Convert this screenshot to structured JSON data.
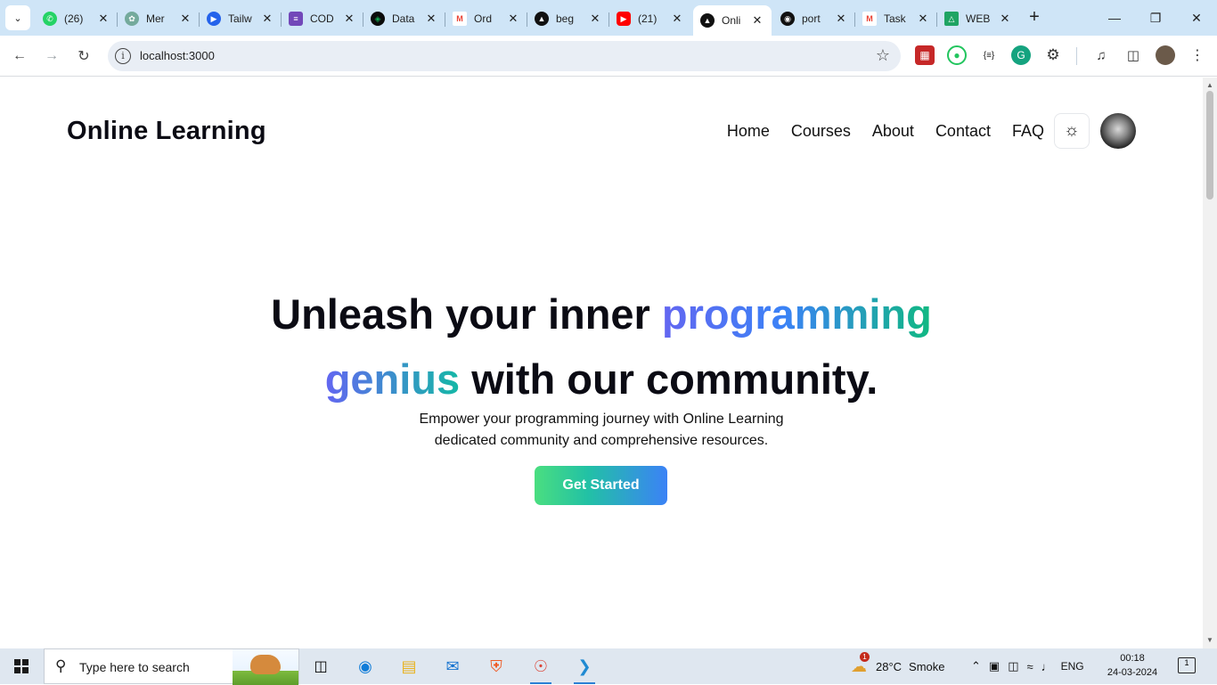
{
  "browser": {
    "tabs": [
      {
        "title": "(26)",
        "icon": "whatsapp-icon",
        "color": "#25D366"
      },
      {
        "title": "Mer",
        "icon": "chatgpt-icon",
        "color": "#74aa9c"
      },
      {
        "title": "Tailw",
        "icon": "video-icon",
        "color": "#2563eb"
      },
      {
        "title": "COD",
        "icon": "forms-icon",
        "color": "#7248b9"
      },
      {
        "title": "Data",
        "icon": "mongodb-icon",
        "color": "#0b0b0b"
      },
      {
        "title": "Ord",
        "icon": "gmail-icon",
        "color": "#ea4335"
      },
      {
        "title": "beg",
        "icon": "vercel-icon",
        "color": "#111111"
      },
      {
        "title": "(21)",
        "icon": "youtube-icon",
        "color": "#ff0000"
      },
      {
        "title": "Onli",
        "icon": "vercel-icon",
        "color": "#111111"
      },
      {
        "title": "port",
        "icon": "github-icon",
        "color": "#111111"
      },
      {
        "title": "Task",
        "icon": "gmail-icon",
        "color": "#ea4335"
      },
      {
        "title": "WEB",
        "icon": "drive-icon",
        "color": "#1fa463"
      }
    ],
    "active_tab_index": 8,
    "url": "localhost:3000"
  },
  "page": {
    "brand": "Online Learning",
    "nav": [
      "Home",
      "Courses",
      "About",
      "Contact",
      "FAQ"
    ],
    "hero": {
      "line1_plain": "Unleash your inner ",
      "line1_grad": "programming",
      "line2_grad": "genius",
      "line2_plain": " with our community.",
      "sub1": "Empower your programming journey with Online Learning",
      "sub2": "dedicated community and comprehensive resources.",
      "cta": "Get Started"
    },
    "accent_colors": {
      "gradient_start": "#6366f1",
      "gradient_mid": "#3b82f6",
      "gradient_end": "#10b981",
      "button_start": "#4ade80",
      "button_end": "#3b82f6"
    }
  },
  "taskbar": {
    "search_placeholder": "Type here to search",
    "weather_temp": "28°C",
    "weather_text": "Smoke",
    "weather_badge": "1",
    "language": "ENG",
    "time": "00:18",
    "date": "24-03-2024",
    "notification_count": "1"
  }
}
